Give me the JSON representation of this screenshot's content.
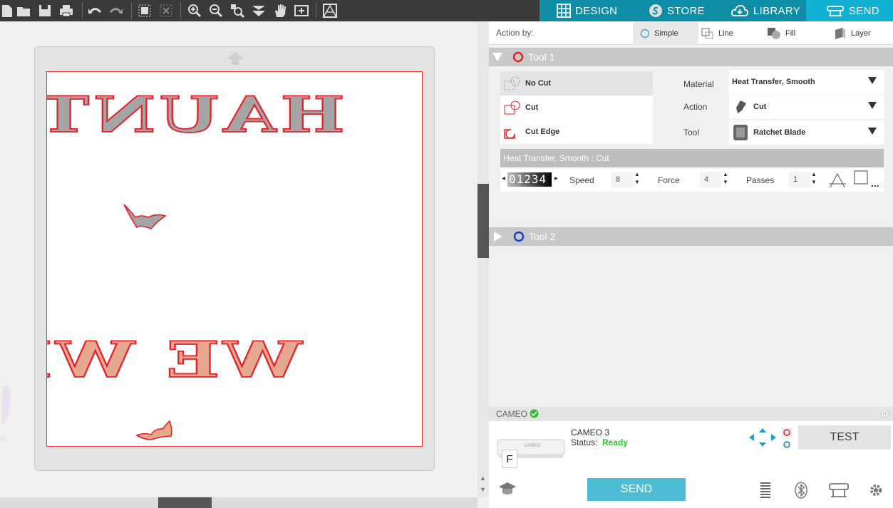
{
  "toolbar": {
    "icons": [
      "new-file-icon",
      "open-folder-icon",
      "save-icon",
      "print-icon",
      "undo-icon",
      "redo-icon",
      "group-icon",
      "ungroup-icon",
      "zoom-in-icon",
      "zoom-out-icon",
      "zoom-fit-icon",
      "move-down-icon",
      "pan-hand-icon",
      "add-page-icon",
      "panels-icon"
    ]
  },
  "tabs": {
    "design": "DESIGN",
    "store": "STORE",
    "library": "LIBRARY",
    "send": "SEND",
    "active": "send"
  },
  "canvas": {
    "text_top": "HAUNTING",
    "text_bottom": "WE WILL",
    "colors": {
      "outline": "#e8202a",
      "fill_top": "#a5a5a5",
      "fill_bottom": "#e6a88f",
      "page_border": "#ee3333"
    }
  },
  "panel": {
    "action_by_label": "Action by:",
    "modes": [
      "Simple",
      "Line",
      "Fill",
      "Layer"
    ],
    "active_mode": "Simple",
    "tool1": {
      "title": "Tool 1",
      "color": "#e8202a",
      "cut_options": [
        "No Cut",
        "Cut",
        "Cut Edge"
      ],
      "selected_cut": "No Cut",
      "material_label": "Material",
      "material": "Heat Transfer, Smooth",
      "action_label": "Action",
      "action": "Cut",
      "tool_label": "Tool",
      "tool": "Ratchet Blade",
      "subheader": "Heat Transfer, Smooth : Cut",
      "blade_digits": "01234",
      "speed_label": "Speed",
      "speed": "8",
      "force_label": "Force",
      "force": "4",
      "passes_label": "Passes",
      "passes": "1",
      "more": "..."
    },
    "tool2": {
      "title": "Tool 2",
      "color": "#1c3fd4"
    }
  },
  "machine": {
    "header": "CAMEO",
    "name": "CAMEO 3",
    "status_label": "Status:",
    "status": "Ready",
    "status_color": "#22cc22",
    "device_mirror_letter": "F",
    "test_label": "TEST",
    "send_label": "SEND"
  }
}
